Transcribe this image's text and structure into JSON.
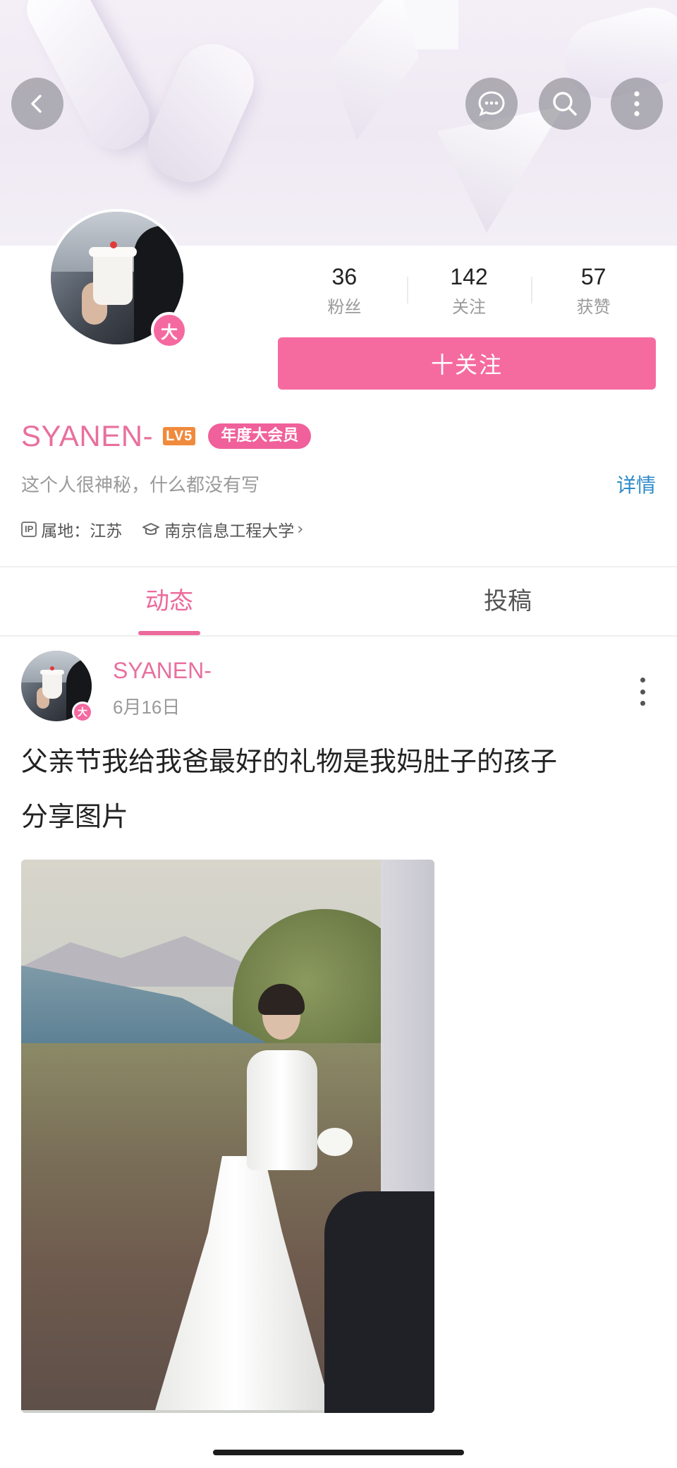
{
  "header": {
    "back_icon": "back-arrow-icon",
    "message_icon": "chat-bubble-icon",
    "search_icon": "search-icon",
    "more_icon": "more-vertical-icon"
  },
  "profile": {
    "avatar_badge": "大",
    "stats": [
      {
        "value": "36",
        "label": "粉丝"
      },
      {
        "value": "142",
        "label": "关注"
      },
      {
        "value": "57",
        "label": "获赞"
      }
    ],
    "follow_label": "十关注",
    "username": "SYANEN-",
    "level_badge": "LV5",
    "vip_badge": "年度大会员",
    "bio": "这个人很神秘，什么都没有写",
    "detail_link": "详情",
    "ip_tag": "IP",
    "ip_location": "属地：江苏",
    "school": "南京信息工程大学",
    "school_chevron": "›"
  },
  "tabs": [
    {
      "label": "动态",
      "active": true
    },
    {
      "label": "投稿",
      "active": false
    }
  ],
  "post": {
    "author": "SYANEN-",
    "date": "6月16日",
    "avatar_badge": "大",
    "text": "父亲节我给我爸最好的礼物是我妈肚子的孩子",
    "subtext": "分享图片"
  },
  "colors": {
    "accent": "#f56ba0",
    "username": "#e8709e",
    "link": "#2f8bc9",
    "level": "#f08a3c"
  }
}
